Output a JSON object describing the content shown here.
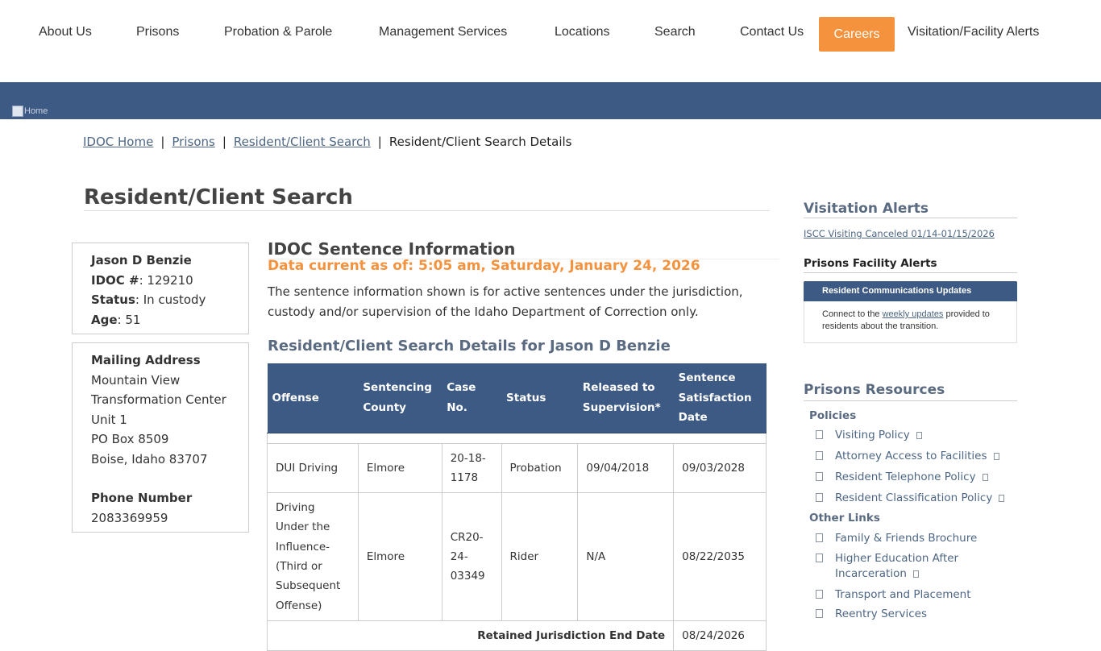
{
  "nav": {
    "items": [
      "About Us",
      "Prisons",
      "Probation & Parole",
      "Management Services",
      "Locations",
      "Search",
      "Contact Us"
    ],
    "careers": "Careers",
    "visitation": "Visitation/Facility Alerts"
  },
  "banner": {
    "home_alt": "Home"
  },
  "breadcrumb": {
    "items": [
      "IDOC Home",
      "Prisons",
      "Resident/Client Search"
    ],
    "current": "Resident/Client Search Details",
    "separator": "|"
  },
  "page_title": "Resident/Client Search",
  "person": {
    "name": "Jason D Benzie",
    "idoc_label": "IDOC #",
    "idoc_number": "129210",
    "status_label": "Status",
    "status": "In custody",
    "age_label": "Age",
    "age": "51"
  },
  "mailing": {
    "label": "Mailing Address",
    "lines": [
      "Mountain View",
      "Transformation Center",
      "Unit 1",
      "PO Box 8509",
      "Boise, Idaho 83707"
    ],
    "phone_label": "Phone Number",
    "phone": "2083369959"
  },
  "sentence": {
    "header": "IDOC Sentence Information",
    "data_current": "Data current as of: 5:05 am, Saturday, January 24, 2026",
    "description": "The sentence information shown is for active sentences under the jurisdiction, custody and/or supervision of the Idaho Department of Correction only.",
    "details_title": "Resident/Client Search Details for Jason D Benzie",
    "columns": [
      "Offense",
      "Sentencing County",
      "Case No.",
      "Status",
      "Released to Supervision*",
      "Sentence Satisfaction Date"
    ],
    "rows": [
      [
        "DUI Driving",
        "Elmore",
        "20-18-1178",
        "Probation",
        "09/04/2018",
        "09/03/2028"
      ],
      [
        "Driving Under the Influence-(Third or Subsequent Offense)",
        "Elmore",
        "CR20-24-03349",
        "Rider",
        "N/A",
        "08/22/2035"
      ]
    ],
    "retained_label": "Retained Jurisdiction End Date",
    "retained_date": "08/24/2026"
  },
  "sidebar": {
    "visitation_title": "Visitation Alerts",
    "visitation_link": "ISCC Visiting Canceled 01/14-01/15/2026",
    "facility_title": "Prisons Facility Alerts",
    "alert_header": "Resident Communications Updates",
    "alert_text_before": "Connect to the ",
    "alert_link": "weekly updates",
    "alert_text_after": " provided to residents about the transition.",
    "resources_title": "Prisons Resources",
    "policies_label": "Policies",
    "policies": [
      "Visiting Policy",
      "Attorney Access to Facilities",
      "Resident Telephone Policy",
      "Resident Classification Policy"
    ],
    "other_label": "Other Links",
    "other_links": [
      "Family & Friends Brochure",
      "Higher Education After Incarceration",
      "Transport and Placement",
      "Reentry Services"
    ]
  }
}
